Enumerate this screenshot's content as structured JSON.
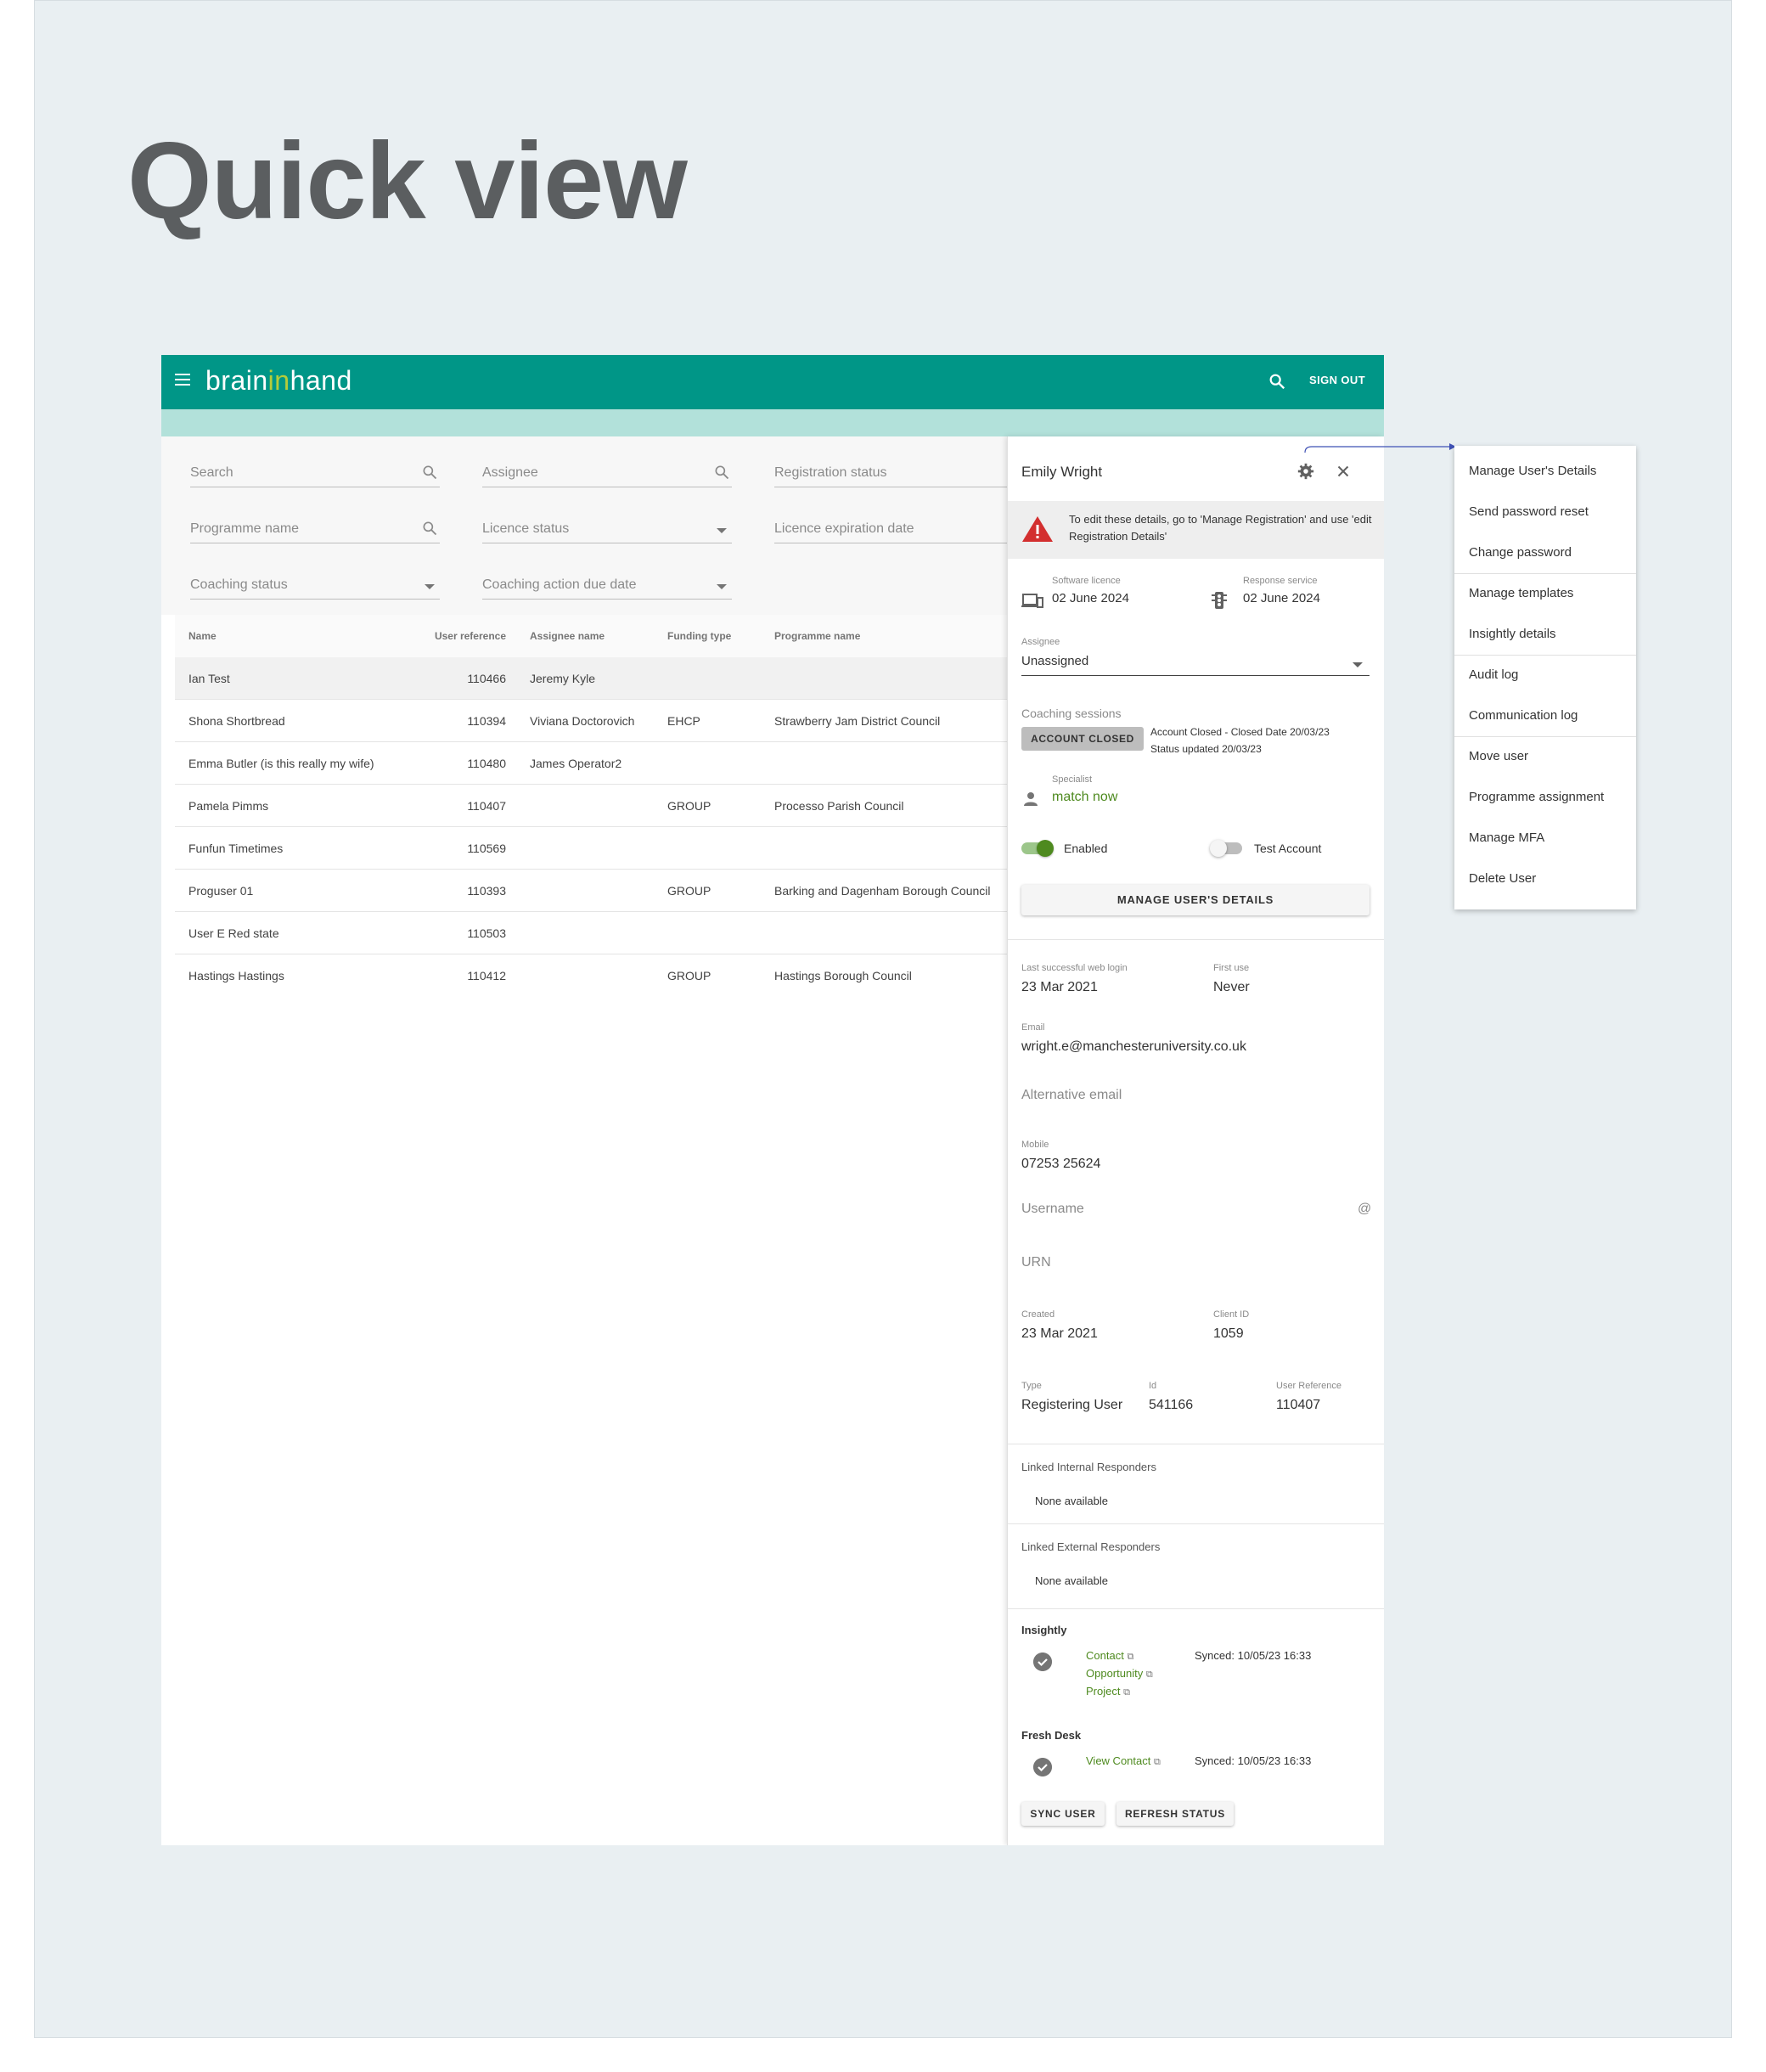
{
  "page_title": "Quick view",
  "appbar": {
    "logo_pre": "brain",
    "logo_mid": "in",
    "logo_post": "hand",
    "sign_out": "SIGN OUT"
  },
  "filters": {
    "search": "Search",
    "assignee": "Assignee",
    "registration_status": "Registration status",
    "programme_name": "Programme name",
    "licence_status": "Licence status",
    "licence_expiration_date": "Licence expiration date",
    "coaching_status": "Coaching status",
    "coaching_action_due_date": "Coaching action due date"
  },
  "table": {
    "headers": {
      "name": "Name",
      "ref": "User reference",
      "assignee": "Assignee name",
      "funding": "Funding type",
      "programme": "Programme name"
    },
    "rows": [
      {
        "name": "Ian Test",
        "ref": "110466",
        "assignee": "Jeremy Kyle",
        "funding": "",
        "programme": ""
      },
      {
        "name": "Shona Shortbread",
        "ref": "110394",
        "assignee": "Viviana Doctorovich",
        "funding": "EHCP",
        "programme": "Strawberry Jam District Council"
      },
      {
        "name": "Emma Butler (is this really my wife)",
        "ref": "110480",
        "assignee": "James Operator2",
        "funding": "",
        "programme": ""
      },
      {
        "name": "Pamela Pimms",
        "ref": "110407",
        "assignee": "",
        "funding": "GROUP",
        "programme": "Processo Parish Council"
      },
      {
        "name": "Funfun Timetimes",
        "ref": "110569",
        "assignee": "",
        "funding": "",
        "programme": ""
      },
      {
        "name": "Proguser 01",
        "ref": "110393",
        "assignee": "",
        "funding": "GROUP",
        "programme": "Barking and Dagenham Borough Council"
      },
      {
        "name": "User E Red state",
        "ref": "110503",
        "assignee": "",
        "funding": "",
        "programme": ""
      },
      {
        "name": "Hastings Hastings",
        "ref": "110412",
        "assignee": "",
        "funding": "GROUP",
        "programme": "Hastings Borough Council"
      }
    ]
  },
  "panel": {
    "name": "Emily Wright",
    "warning": "To edit these details, go to 'Manage Registration' and use 'edit Registration Details'",
    "software_licence_label": "Software licence",
    "software_licence": "02 June 2024",
    "response_service_label": "Response service",
    "response_service": "02 June 2024",
    "assignee_label": "Assignee",
    "assignee": "Unassigned",
    "coaching_label": "Coaching sessions",
    "badge": "ACCOUNT CLOSED",
    "closed_line1": "Account Closed - Closed Date 20/03/23",
    "closed_line2": "Status updated 20/03/23",
    "specialist_label": "Specialist",
    "specialist": "match now",
    "enabled": "Enabled",
    "test_account": "Test Account",
    "manage_button": "MANAGE USER'S DETAILS",
    "last_login_label": "Last successful web login",
    "last_login": "23 Mar 2021",
    "first_use_label": "First use",
    "first_use": "Never",
    "email_label": "Email",
    "email": "wright.e@manchesteruniversity.co.uk",
    "alt_email": "Alternative email",
    "mobile_label": "Mobile",
    "mobile": "07253 25624",
    "username": "Username",
    "at": "@",
    "urn": "URN",
    "created_label": "Created",
    "created": "23 Mar 2021",
    "client_id_label": "Client ID",
    "client_id": "1059",
    "type_label": "Type",
    "type": "Registering User",
    "id_label": "Id",
    "id": "541166",
    "user_ref_label": "User Reference",
    "user_ref": "110407",
    "linked_internal": "Linked Internal Responders",
    "none1": "None available",
    "linked_external": "Linked External Responders",
    "none2": "None available",
    "insightly": "Insightly",
    "contact": "Contact",
    "opportunity": "Opportunity",
    "project": "Project",
    "synced1": "Synced: 10/05/23 16:33",
    "freshdesk": "Fresh Desk",
    "view_contact": "View Contact",
    "synced2": "Synced: 10/05/23 16:33",
    "sync_user": "SYNC USER",
    "refresh_status": "REFRESH STATUS"
  },
  "menu": [
    "Manage User's Details",
    "Send password reset",
    "Change password",
    "Manage templates",
    "Insightly details",
    "Audit log",
    "Communication log",
    "Move user",
    "Programme assignment",
    "Manage MFA",
    "Delete User"
  ],
  "colors": {
    "teal": "#009687",
    "teal_light": "#b2e1da",
    "green": "#4e8a1f",
    "warning": "#d32f2f"
  }
}
